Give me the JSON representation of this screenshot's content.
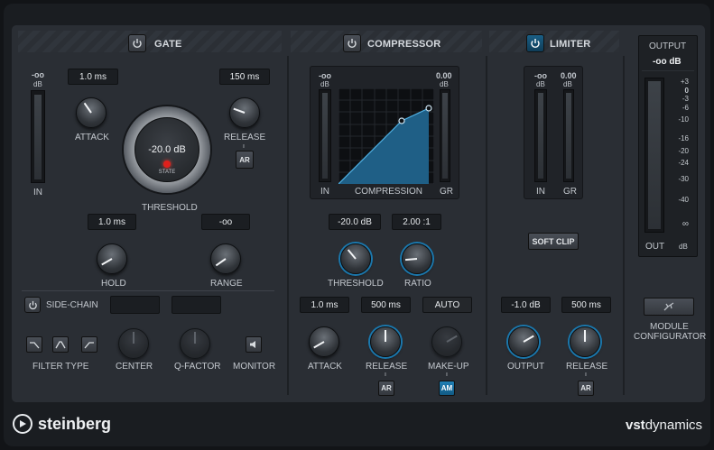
{
  "plugin": {
    "brand": "steinberg",
    "product_prefix": "vst",
    "product_suffix": "dynamics"
  },
  "gate": {
    "title": "GATE",
    "meter_top": "-oo",
    "meter_unit": "dB",
    "meter_in": "IN",
    "attack_value": "1.0 ms",
    "attack_label": "ATTACK",
    "release_value": "150 ms",
    "release_label": "RELEASE",
    "ar_label": "AR",
    "threshold_value": "-20.0 dB",
    "state_label": "STATE",
    "threshold_label": "THRESHOLD",
    "hold_value": "1.0 ms",
    "hold_label": "HOLD",
    "range_value": "-oo",
    "range_label": "RANGE"
  },
  "sidechain": {
    "title": "SIDE-CHAIN",
    "filter_type_label": "FILTER TYPE",
    "center_label": "CENTER",
    "qfactor_label": "Q-FACTOR",
    "monitor_label": "MONITOR"
  },
  "compressor": {
    "title": "COMPRESSOR",
    "meter_left_top": "-oo",
    "meter_right_top": "0.00",
    "meter_unit": "dB",
    "in_label": "IN",
    "graph_label": "COMPRESSION",
    "gr_label": "GR",
    "threshold_value": "-20.0 dB",
    "threshold_label": "THRESHOLD",
    "ratio_value": "2.00 :1",
    "ratio_label": "RATIO",
    "attack_value": "1.0 ms",
    "attack_label": "ATTACK",
    "release_value": "500 ms",
    "release_label": "RELEASE",
    "makeup_value": "AUTO",
    "makeup_label": "MAKE-UP",
    "ar_label": "AR",
    "am_label": "AM"
  },
  "limiter": {
    "title": "LIMITER",
    "meter_left_top": "-oo",
    "meter_right_top": "0.00",
    "meter_unit": "dB",
    "in_label": "IN",
    "gr_label": "GR",
    "soft_clip_label": "SOFT CLIP",
    "output_value": "-1.0 dB",
    "output_label": "OUTPUT",
    "release_value": "500 ms",
    "release_label": "RELEASE",
    "ar_label": "AR"
  },
  "output": {
    "title": "OUTPUT",
    "value": "-oo dB",
    "out_label": "OUT",
    "unit_label": "dB",
    "scale": [
      "+3",
      "0",
      "-3",
      "-6",
      "-10",
      "-16",
      "-20",
      "-24",
      "-30",
      "-40",
      "∞"
    ]
  },
  "module_configurator": {
    "line1": "MODULE",
    "line2": "CONFIGURATOR"
  },
  "colors": {
    "accent": "#1b78ad",
    "panel": "#2a2e34",
    "graph_fill": "#1f5f86",
    "state_led": "#e0201c"
  }
}
